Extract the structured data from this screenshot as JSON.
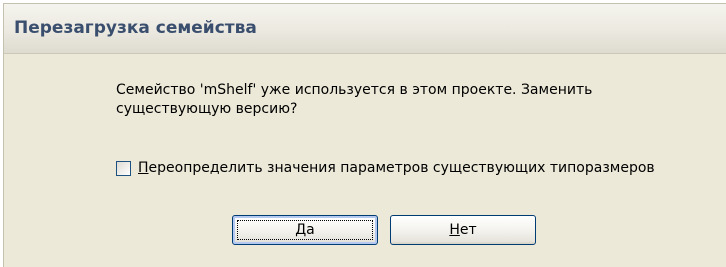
{
  "dialog": {
    "title": "Перезагрузка семейства",
    "message": "Семейство 'mShelf' уже используется в этом проекте. Заменить существующую версию?",
    "checkbox": {
      "checked": false,
      "label_accel": "П",
      "label_rest": "ереопределить значения параметров существующих типоразмеров"
    },
    "buttons": {
      "yes_accel": "Д",
      "yes_rest": "а",
      "no_accel": "Н",
      "no_rest": "ет"
    }
  }
}
